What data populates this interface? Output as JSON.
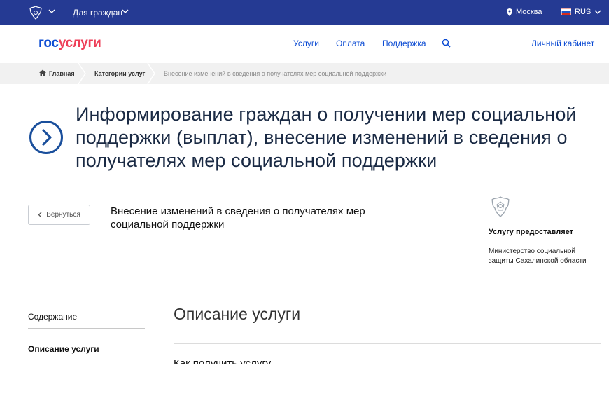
{
  "topbar": {
    "audience": "Для граждан",
    "city": "Москва",
    "lang": "RUS"
  },
  "header": {
    "logo_part1": "гос",
    "logo_part2": "услуги",
    "nav": [
      "Услуги",
      "Оплата",
      "Поддержка"
    ],
    "cabinet": "Личный кабинет"
  },
  "breadcrumb": {
    "home": "Главная",
    "category": "Категории услуг",
    "current": "Внесение изменений в сведения о получателях мер социальной поддержки"
  },
  "page": {
    "title_line1": "Информирование граждан о получении мер социальной",
    "title_line2": "поддержки (выплат), внесение изменений в сведения о",
    "title_line3": "получателях мер социальной поддержки",
    "back_label": "Вернуться",
    "subtitle_line1": "Внесение изменений в сведения о получателях мер",
    "subtitle_line2": "социальной поддержки"
  },
  "provider": {
    "label": "Услугу предоставляет",
    "name_line1": "Министерство социальной",
    "name_line2": "защиты Сахалинской области"
  },
  "sidebar": {
    "items": [
      "Содержание",
      "Описание услуги"
    ]
  },
  "content": {
    "section_title": "Описание услуги",
    "howto": "Как получить услугу"
  },
  "colors": {
    "topbar": "#253a93",
    "link": "#0d4cd3",
    "logo_red": "#ee3f58",
    "accent_circle": "#1a4f9c"
  }
}
